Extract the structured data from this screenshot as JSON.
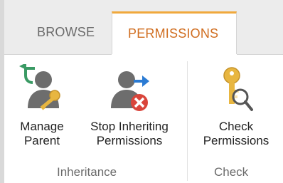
{
  "tabs": [
    {
      "label": "BROWSE",
      "active": false
    },
    {
      "label": "PERMISSIONS",
      "active": true
    }
  ],
  "groups": [
    {
      "label": "Inheritance",
      "buttons": [
        {
          "label_line1": "Manage",
          "label_line2": "Parent",
          "icon": "manage-parent-icon"
        },
        {
          "label_line1": "Stop Inheriting",
          "label_line2": "Permissions",
          "icon": "stop-inheriting-icon"
        }
      ]
    },
    {
      "label": "Check",
      "buttons": [
        {
          "label_line1": "Check",
          "label_line2": "Permissions",
          "icon": "check-permissions-icon"
        }
      ]
    }
  ],
  "colors": {
    "accent_orange": "#f0a93c",
    "active_tab_text": "#d06d1f",
    "arrow_green": "#3a9a64",
    "arrow_blue": "#2b7bd3",
    "stop_red": "#d9453b",
    "key_gold": "#e8b640"
  }
}
